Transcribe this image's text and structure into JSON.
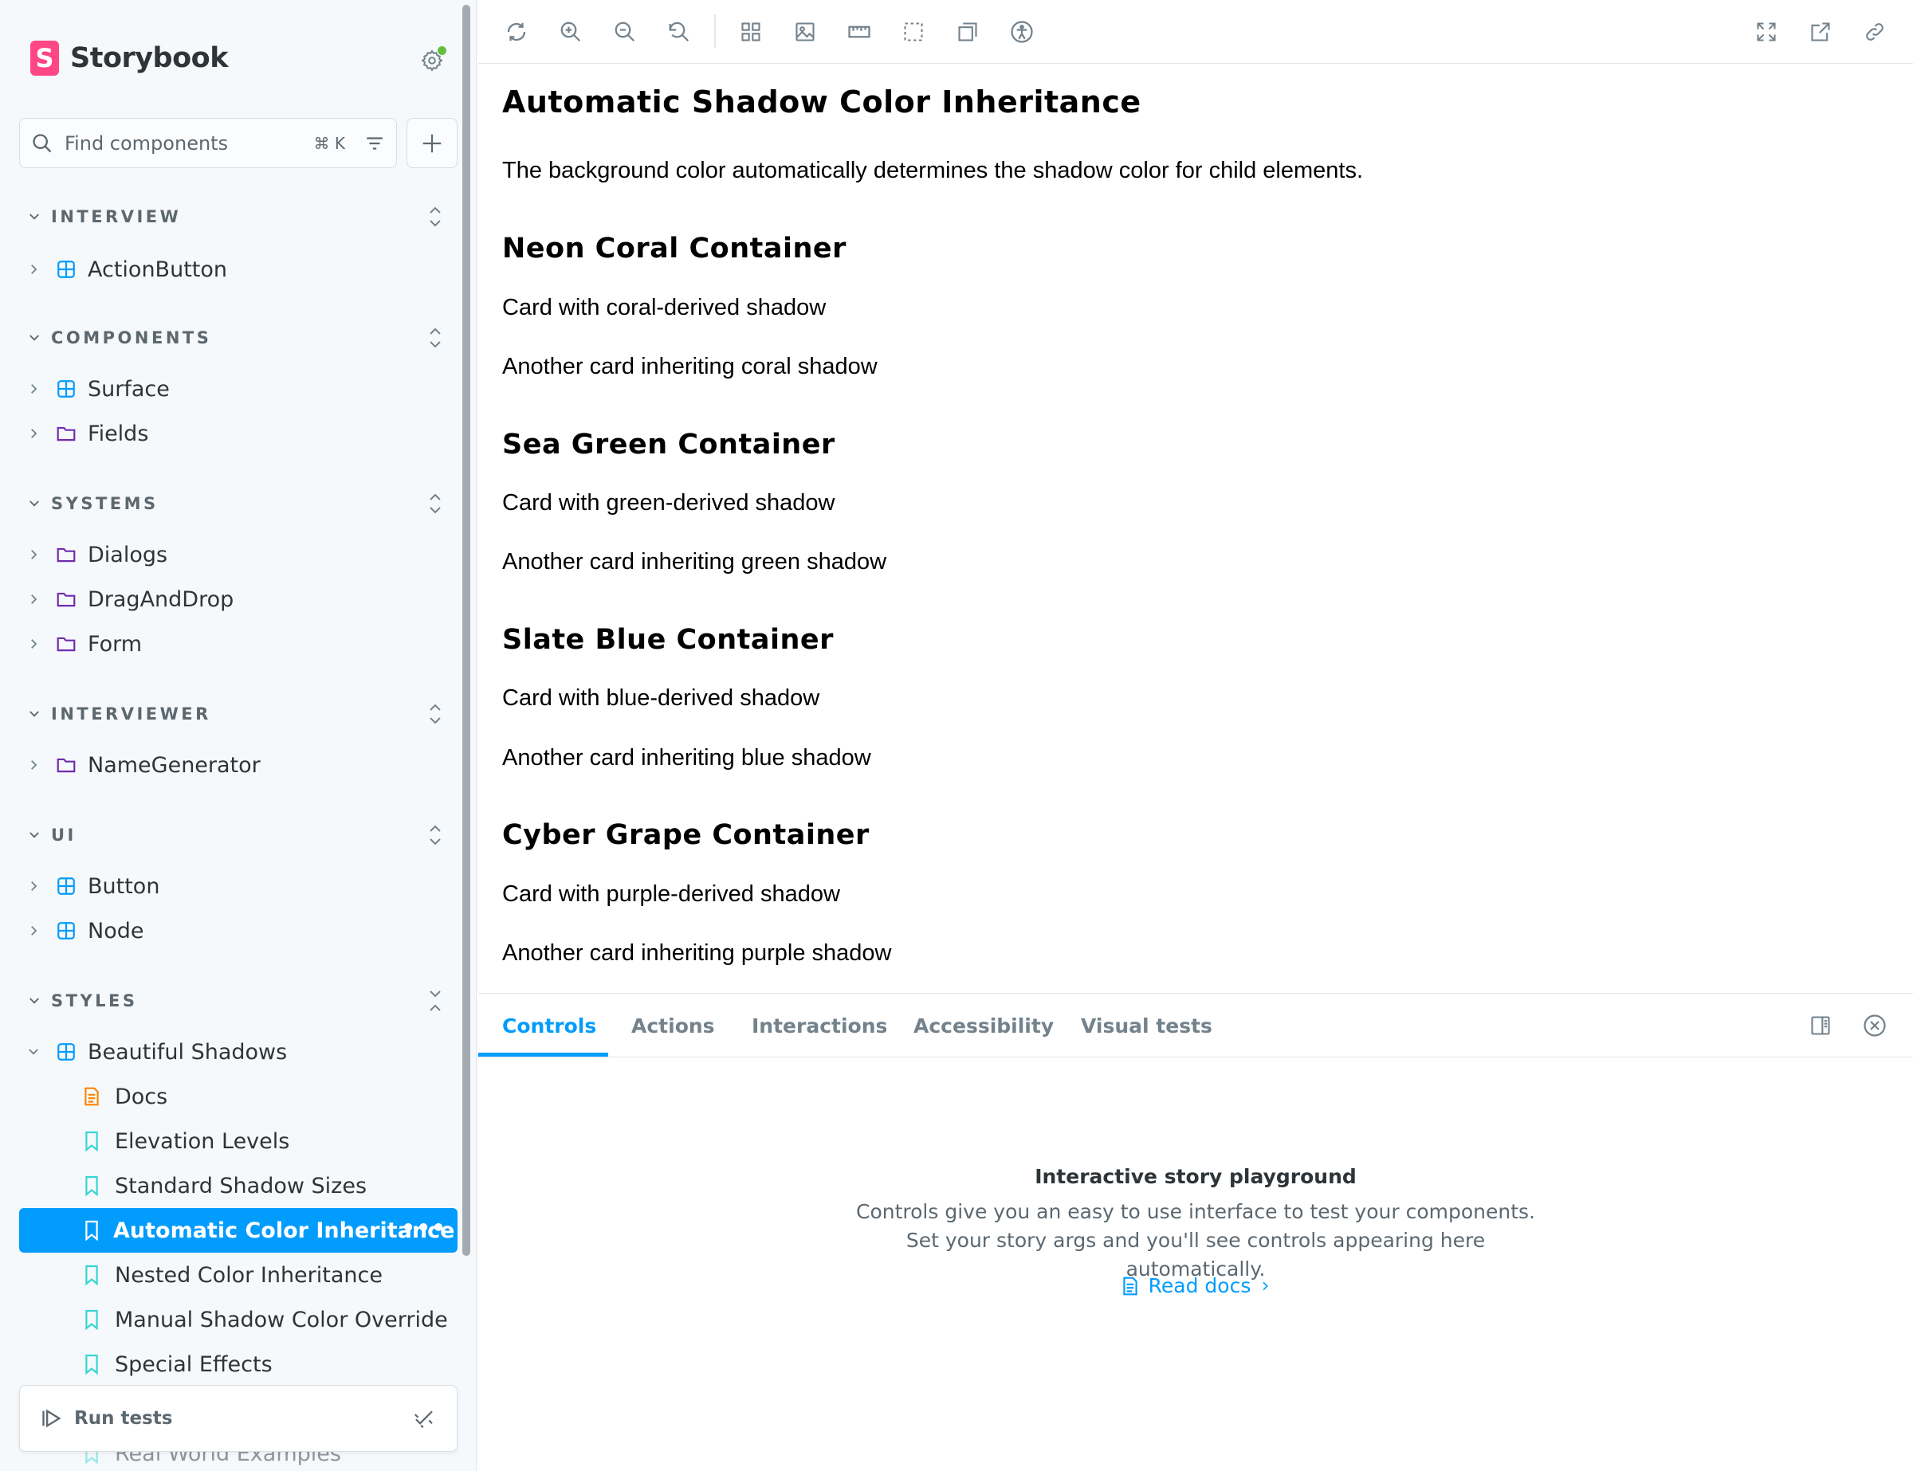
{
  "brand": {
    "name": "Storybook",
    "logo_letter": "S",
    "color": "#ff4785"
  },
  "search": {
    "placeholder": "Find components",
    "shortcut": "⌘ K"
  },
  "sidebar": {
    "sections": [
      {
        "title": "INTERVIEW",
        "items": [
          {
            "label": "ActionButton",
            "icon": "component-icon"
          }
        ]
      },
      {
        "title": "COMPONENTS",
        "items": [
          {
            "label": "Surface",
            "icon": "component-icon"
          },
          {
            "label": "Fields",
            "icon": "folder-icon"
          }
        ]
      },
      {
        "title": "SYSTEMS",
        "items": [
          {
            "label": "Dialogs",
            "icon": "folder-icon"
          },
          {
            "label": "DragAndDrop",
            "icon": "folder-icon"
          },
          {
            "label": "Form",
            "icon": "folder-icon"
          }
        ]
      },
      {
        "title": "INTERVIEWER",
        "items": [
          {
            "label": "NameGenerator",
            "icon": "folder-icon"
          }
        ]
      },
      {
        "title": "UI",
        "items": [
          {
            "label": "Button",
            "icon": "component-icon"
          },
          {
            "label": "Node",
            "icon": "component-icon"
          }
        ]
      },
      {
        "title": "STYLES",
        "items": [
          {
            "label": "Beautiful Shadows",
            "icon": "component-icon"
          }
        ]
      }
    ],
    "stories": [
      {
        "label": "Docs",
        "icon": "docs-icon"
      },
      {
        "label": "Elevation Levels",
        "icon": "bookmark-icon"
      },
      {
        "label": "Standard Shadow Sizes",
        "icon": "bookmark-icon"
      },
      {
        "label": "Automatic Color Inheritance",
        "icon": "bookmark-icon",
        "selected": true
      },
      {
        "label": "Nested Color Inheritance",
        "icon": "bookmark-icon"
      },
      {
        "label": "Manual Shadow Color Override",
        "icon": "bookmark-icon"
      },
      {
        "label": "Special Effects",
        "icon": "bookmark-icon"
      },
      {
        "label": "Real World Examples",
        "icon": "bookmark-icon"
      }
    ],
    "selected_more": "•••",
    "run_tests": "Run tests"
  },
  "toolbar": {
    "left": [
      "reload-icon",
      "zoom-in-icon",
      "zoom-out-icon",
      "zoom-reset-icon",
      "grid-icon",
      "background-icon",
      "ruler-icon",
      "outline-icon",
      "viewport-icon",
      "accessibility-icon"
    ],
    "right": [
      "fullscreen-icon",
      "open-new-tab-icon",
      "copy-link-icon"
    ]
  },
  "preview": {
    "title": "Automatic Shadow Color Inheritance",
    "intro": "The background color automatically determines the shadow color for child elements.",
    "groups": [
      {
        "heading": "Neon Coral Container",
        "cards": [
          "Card with coral-derived shadow",
          "Another card inheriting coral shadow"
        ]
      },
      {
        "heading": "Sea Green Container",
        "cards": [
          "Card with green-derived shadow",
          "Another card inheriting green shadow"
        ]
      },
      {
        "heading": "Slate Blue Container",
        "cards": [
          "Card with blue-derived shadow",
          "Another card inheriting blue shadow"
        ]
      },
      {
        "heading": "Cyber Grape Container",
        "cards": [
          "Card with purple-derived shadow",
          "Another card inheriting purple shadow"
        ]
      }
    ]
  },
  "panel": {
    "tabs": [
      "Controls",
      "Actions",
      "Interactions",
      "Accessibility",
      "Visual tests"
    ],
    "active_tab": "Controls",
    "empty_title": "Interactive story playground",
    "empty_desc": "Controls give you an easy to use interface to test your components. Set your story args and you'll see controls appearing here automatically.",
    "read_docs": "Read docs"
  },
  "colors": {
    "accent": "#029cfd",
    "component": "#029cfd",
    "folder": "#6f2cac",
    "docs": "#ff8300",
    "story": "#37d5d3",
    "status_ok": "#66bf3c"
  }
}
